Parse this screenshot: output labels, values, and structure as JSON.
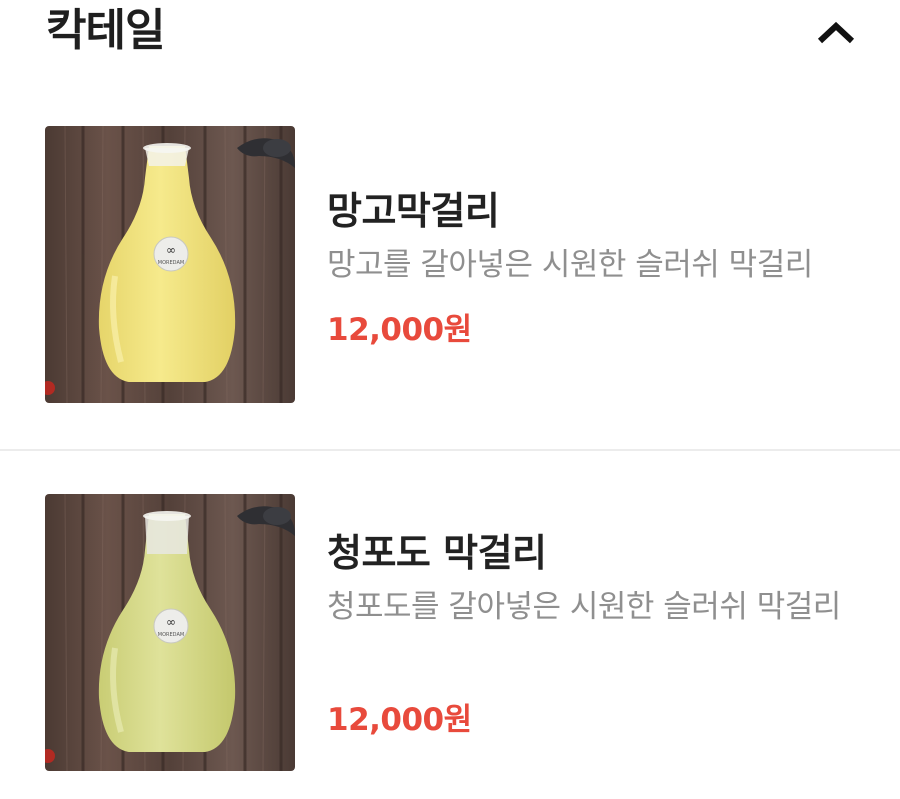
{
  "section": {
    "title": "칵테일",
    "collapse_icon": "chevron-up-icon"
  },
  "items": [
    {
      "name": "망고막걸리",
      "description": "망고를 갈아넣은 시원한 슬러쉬 막걸리",
      "price": "12,000원",
      "image_logo_text": "MOREDAM",
      "liquid_color": "#f1e27a"
    },
    {
      "name": "청포도 막걸리",
      "description": "청포도를 갈아넣은 시원한 슬러쉬 막걸리",
      "price": "12,000원",
      "image_logo_text": "MOREDAM",
      "liquid_color": "#d8dc86"
    }
  ],
  "colors": {
    "price": "#e84a3c",
    "title": "#1f1f1f",
    "description": "#8f8f8f",
    "divider": "#ececec"
  }
}
